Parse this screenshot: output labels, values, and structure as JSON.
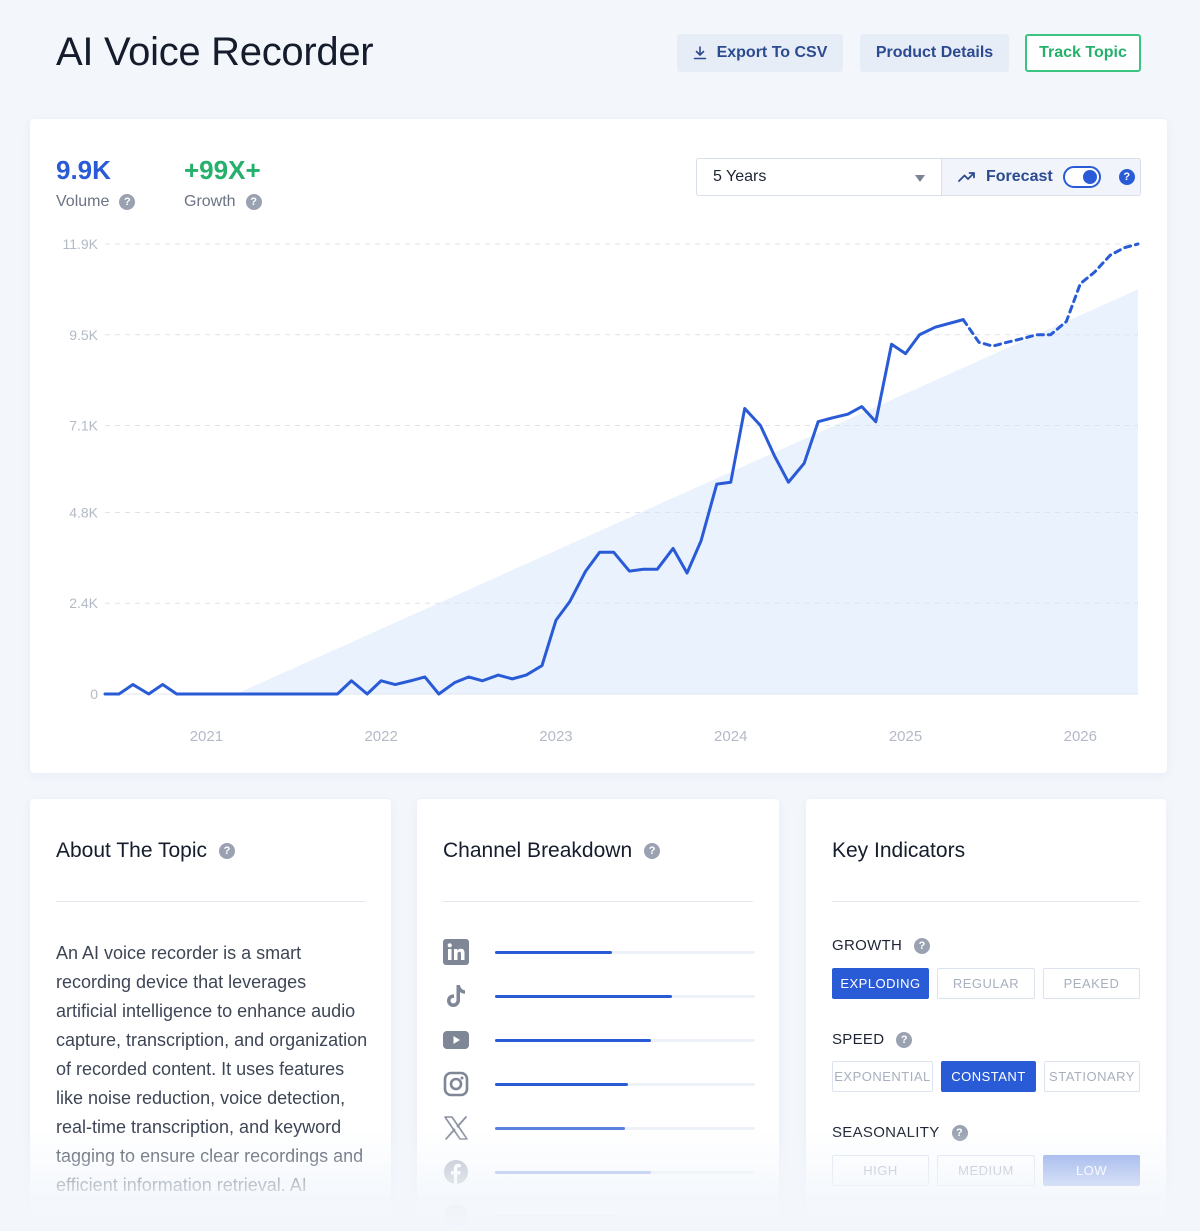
{
  "header": {
    "title": "AI Voice Recorder",
    "export_label": "Export To CSV",
    "details_label": "Product Details",
    "track_label": "Track Topic"
  },
  "metrics": {
    "volume_value": "9.9K",
    "volume_label": "Volume",
    "growth_value": "+99X+",
    "growth_label": "Growth"
  },
  "controls": {
    "range_selected": "5 Years",
    "forecast_label": "Forecast",
    "forecast_on": true
  },
  "colors": {
    "accent": "#2a5bd7",
    "growth": "#25b06b",
    "area": "#eaf2fd"
  },
  "chart_data": {
    "type": "line",
    "xlabel": "",
    "ylabel": "",
    "ylim": [
      0,
      11900
    ],
    "yticks": [
      0,
      2400,
      4800,
      7100,
      9500,
      11900
    ],
    "ytick_labels": [
      "0",
      "2.4K",
      "4.8K",
      "7.1K",
      "9.5K",
      "11.9K"
    ],
    "xlim": [
      2020.42,
      2026.33
    ],
    "xticks": [
      2021,
      2022,
      2023,
      2024,
      2025,
      2026
    ],
    "xtick_labels": [
      "2021",
      "2022",
      "2023",
      "2024",
      "2025",
      "2026"
    ],
    "grid": true,
    "series": [
      {
        "style": "solid",
        "x": [
          2020.42,
          2020.5,
          2020.58,
          2020.67,
          2020.75,
          2020.83,
          2021.0,
          2021.5,
          2021.75,
          2021.83,
          2021.92,
          2022.0,
          2022.08,
          2022.17,
          2022.25,
          2022.33,
          2022.42,
          2022.5,
          2022.58,
          2022.67,
          2022.75,
          2022.83,
          2022.92,
          2023.0,
          2023.08,
          2023.17,
          2023.25,
          2023.33,
          2023.42,
          2023.5,
          2023.58,
          2023.67,
          2023.75,
          2023.83,
          2023.92,
          2024.0,
          2024.08,
          2024.17,
          2024.25,
          2024.33,
          2024.42,
          2024.5,
          2024.58,
          2024.67,
          2024.75,
          2024.83,
          2024.92,
          2025.0,
          2025.08,
          2025.17,
          2025.33
        ],
        "y": [
          0,
          0,
          250,
          0,
          250,
          0,
          0,
          0,
          0,
          350,
          0,
          350,
          250,
          350,
          450,
          0,
          300,
          450,
          350,
          500,
          400,
          500,
          750,
          1950,
          2450,
          3250,
          3750,
          3750,
          3250,
          3300,
          3300,
          3850,
          3200,
          4050,
          5550,
          5600,
          7550,
          7100,
          6300,
          5600,
          6100,
          7200,
          7300,
          7400,
          7600,
          7200,
          9250,
          9000,
          9500,
          9700,
          9900
        ]
      },
      {
        "style": "dashed",
        "x": [
          2025.33,
          2025.42,
          2025.5,
          2025.58,
          2025.67,
          2025.75,
          2025.83,
          2025.92,
          2026.0,
          2026.08,
          2026.17,
          2026.25,
          2026.33
        ],
        "y": [
          9900,
          9300,
          9200,
          9300,
          9400,
          9500,
          9500,
          9850,
          10850,
          11150,
          11600,
          11800,
          11900
        ]
      }
    ],
    "area": {
      "x": [
        2021.17,
        2026.33
      ],
      "y": [
        0,
        10700
      ]
    }
  },
  "about": {
    "title": "About The Topic",
    "text": "An AI voice recorder is a smart recording device that leverages artificial intelligence to enhance audio capture, transcription, and organization of recorded content. It uses features like noise reduction, voice detection, real-time transcription, and keyword tagging to ensure clear recordings and efficient information retrieval. AI"
  },
  "channels": {
    "title": "Channel Breakdown",
    "items": [
      {
        "icon": "linkedin-icon",
        "share": 0.45
      },
      {
        "icon": "tiktok-icon",
        "share": 0.68
      },
      {
        "icon": "youtube-icon",
        "share": 0.6
      },
      {
        "icon": "instagram-icon",
        "share": 0.51
      },
      {
        "icon": "x-icon",
        "share": 0.5
      },
      {
        "icon": "facebook-icon",
        "share": 0.6
      },
      {
        "icon": "pinterest-icon",
        "share": 0.48
      }
    ]
  },
  "indicators": {
    "title": "Key Indicators",
    "growth": {
      "label": "GROWTH",
      "options": [
        "EXPLODING",
        "REGULAR",
        "PEAKED"
      ],
      "selected": "EXPLODING"
    },
    "speed": {
      "label": "SPEED",
      "options": [
        "EXPONENTIAL",
        "CONSTANT",
        "STATIONARY"
      ],
      "selected": "CONSTANT"
    },
    "seasonality": {
      "label": "SEASONALITY",
      "options": [
        "HIGH",
        "MEDIUM",
        "LOW"
      ],
      "selected": "LOW"
    }
  }
}
